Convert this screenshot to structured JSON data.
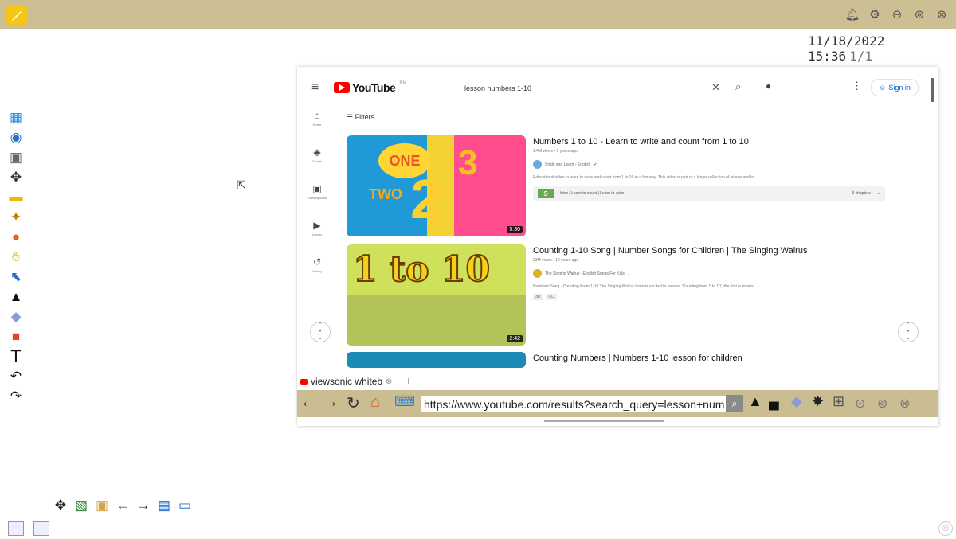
{
  "colors": {
    "topbar": "#cbbf93",
    "navbar": "#c9bd91",
    "accent": "#f5c518",
    "youtube_red": "#ff0000",
    "link_blue": "#065fd4"
  },
  "header": {
    "datetime": "11/18/2022 15:36",
    "page_indicator": "1/1",
    "icons": [
      "bell-icon",
      "gear-icon",
      "minimize-icon",
      "maximize-icon",
      "close-icon"
    ]
  },
  "youtube": {
    "logo_text": "YouTube",
    "logo_region": "EN",
    "search_value": "lesson numbers 1-10",
    "signin_label": "Sign in",
    "filters_label": "Filters",
    "sidebar": [
      {
        "icon": "home-icon",
        "label": "Home"
      },
      {
        "icon": "shorts-icon",
        "label": "Shorts"
      },
      {
        "icon": "subscriptions-icon",
        "label": "Subscriptions"
      },
      {
        "icon": "library-icon",
        "label": "Library"
      },
      {
        "icon": "history-icon",
        "label": "History"
      }
    ],
    "videos": [
      {
        "title": "Numbers 1 to 10 - Learn to write and count from 1 to 10",
        "meta": "1.4M views • 5 years ago",
        "channel": "Smile and Learn - English",
        "description": "Educational video to learn to write and count from 1 to 10 in a fun way. This video is part of a larger collection of videos and lo...",
        "chapters_first": "Intro | Learn to count | Learn to write",
        "chapters_count": "3 chapters",
        "duration": "5:30",
        "thumb_text_1": "ONE",
        "thumb_text_2": "TWO"
      },
      {
        "title": "Counting 1-10 Song | Number Songs for Children | The Singing Walrus",
        "meta": "93M views • 10 years ago",
        "channel": "The Singing Walrus - English Songs For Kids",
        "description": "Numbers Song - Counting From 1-10 The Singing Walrus team is excited to present 'Counting from 1 to 10', the first numbers...",
        "tags": [
          "3D",
          "CC"
        ],
        "duration": "2:42",
        "thumb_text": "1 to 10"
      },
      {
        "title": "Counting Numbers | Numbers 1-10 lesson for children"
      }
    ]
  },
  "browser": {
    "tab_title": "viewsonic whiteb",
    "url": "https://www.youtube.com/results?search_query=lesson+num"
  }
}
